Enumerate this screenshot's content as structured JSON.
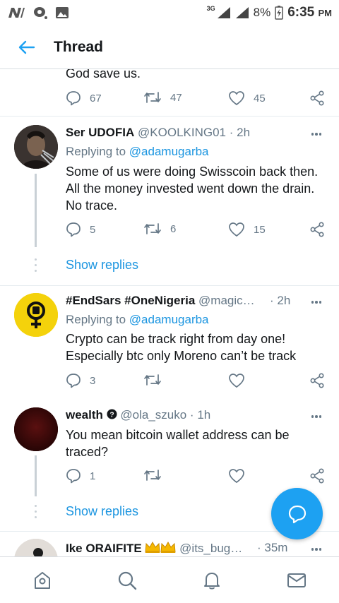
{
  "status_bar": {
    "network": "3G",
    "battery": "8%",
    "time": "6:35",
    "ampm": "PM"
  },
  "header": {
    "title": "Thread"
  },
  "top_tweet": {
    "body_tail": "God save us.",
    "replies": "67",
    "retweets": "47",
    "likes": "45"
  },
  "tweets": [
    {
      "name": "Ser UDOFIA",
      "handle": "@KOOLKING01",
      "time": "2h",
      "replying_prefix": "Replying to",
      "replying_to": "@adamugarba",
      "body": "Some of us were doing Swisscoin back then. All the money invested went down the drain. No trace.",
      "replies": "5",
      "retweets": "6",
      "likes": "15",
      "show_replies": "Show replies"
    },
    {
      "name": "#EndSars #OneNigeria",
      "handle": "@magic…",
      "time": "2h",
      "replying_prefix": "Replying to",
      "replying_to": "@adamugarba",
      "body": "Crypto can be track right from day one! Especially btc only Moreno can’t be track",
      "replies": "3",
      "retweets": "",
      "likes": ""
    },
    {
      "name": "wealth",
      "handle": "@ola_szuko",
      "time": "1h",
      "body": "You mean bitcoin wallet address can be traced?",
      "replies": "1",
      "retweets": "",
      "likes": "",
      "show_replies": "Show replies"
    },
    {
      "name": "Ike ORAIFITE",
      "handle": "@its_bug…",
      "time": "35m"
    }
  ],
  "colors": {
    "accent": "#1da1f2",
    "link": "#1b95e0",
    "muted": "#657786",
    "text": "#14171a",
    "avatar_yellow": "#f4d20b",
    "avatar_dark_red": "#3d0a0a"
  },
  "tabbar": {
    "items": [
      "home-icon",
      "search-icon",
      "notifications-bell-icon",
      "messages-envelope-icon"
    ]
  }
}
